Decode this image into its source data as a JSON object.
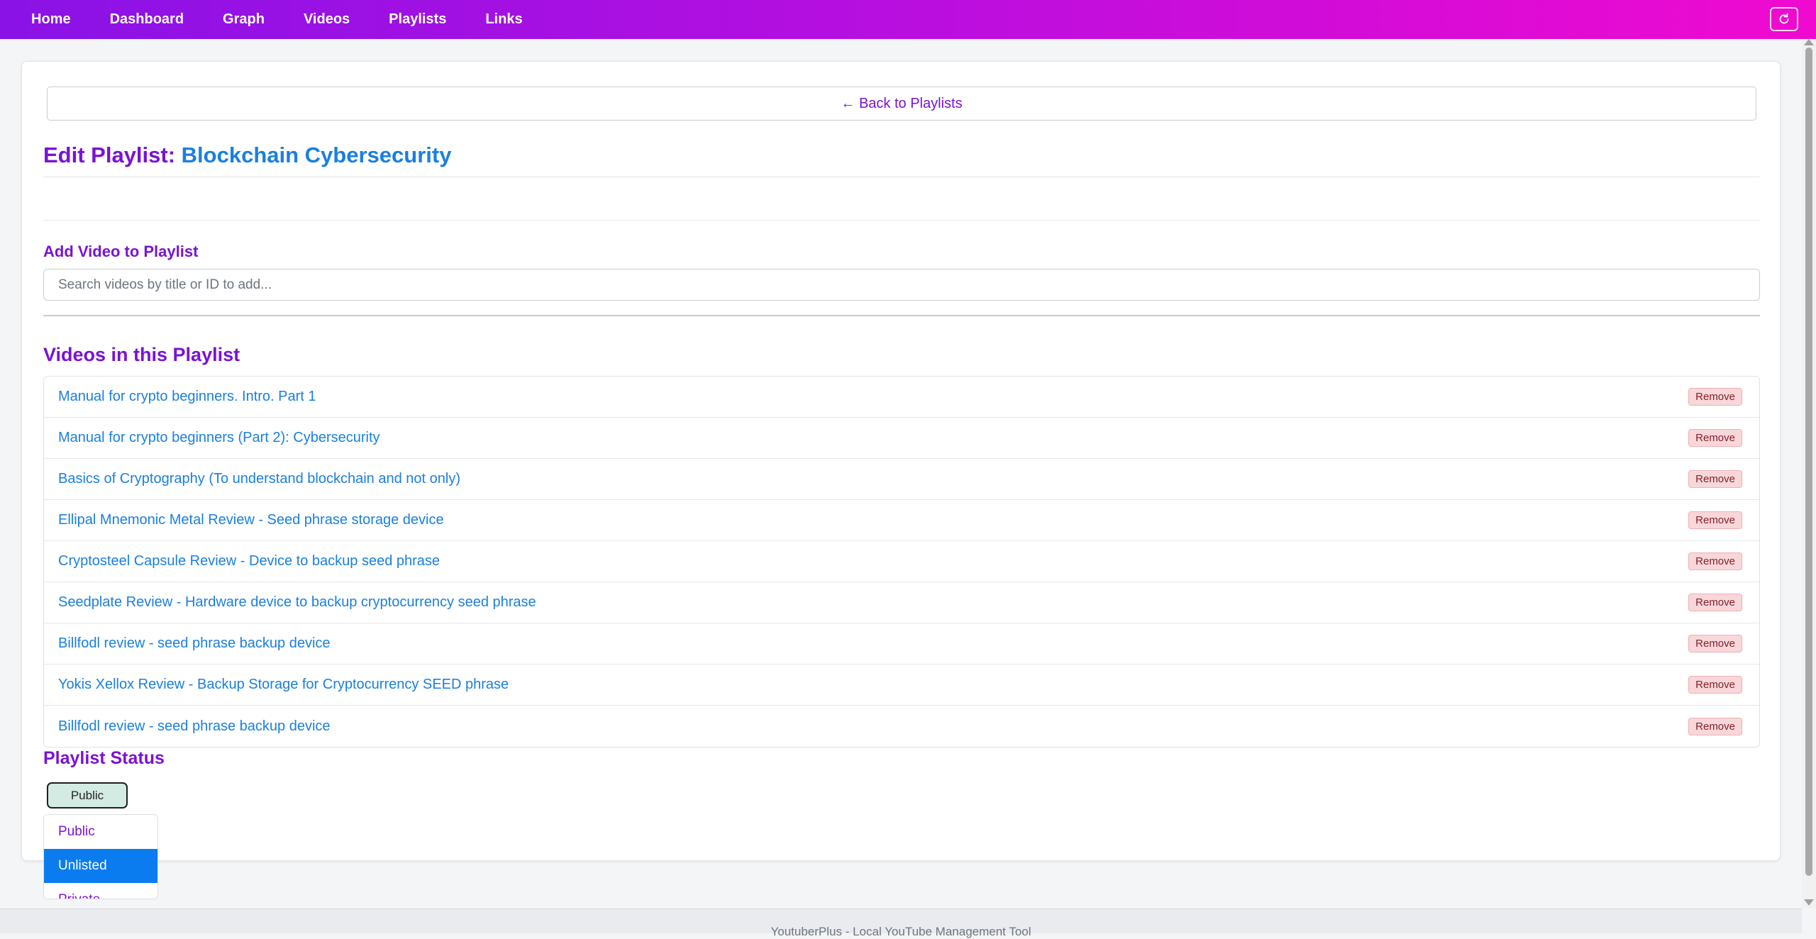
{
  "nav": {
    "items": [
      "Home",
      "Dashboard",
      "Graph",
      "Videos",
      "Playlists",
      "Links"
    ]
  },
  "back_link": "← Back to Playlists",
  "title": {
    "prefix": "Edit Playlist:",
    "playlist_name": "Blockchain Cybersecurity"
  },
  "add_video": {
    "heading": "Add Video to Playlist",
    "placeholder": "Search videos by title or ID to add..."
  },
  "videos": {
    "heading": "Videos in this Playlist",
    "remove_label": "Remove",
    "items": [
      "Manual for crypto beginners. Intro. Part 1",
      "Manual for crypto beginners (Part 2): Cybersecurity",
      "Basics of Cryptography (To understand blockchain and not only)",
      "Ellipal Mnemonic Metal Review - Seed phrase storage device",
      "Cryptosteel Capsule Review - Device to backup seed phrase",
      "Seedplate Review - Hardware device to backup cryptocurrency seed phrase",
      "Billfodl review - seed phrase backup device",
      "Yokis Xellox Review - Backup Storage for Cryptocurrency SEED phrase",
      "Billfodl review - seed phrase backup device"
    ]
  },
  "status": {
    "heading": "Playlist Status",
    "current": "Public",
    "options": [
      "Public",
      "Unlisted",
      "Private"
    ],
    "highlighted": "Unlisted"
  },
  "footer": "YoutuberPlus - Local YouTube Management Tool",
  "colors": {
    "accent_purple": "#7a12d6",
    "link_blue": "#1a7fe0",
    "nav_gradient_start": "#8a12e6",
    "nav_gradient_end": "#f00ad0"
  }
}
